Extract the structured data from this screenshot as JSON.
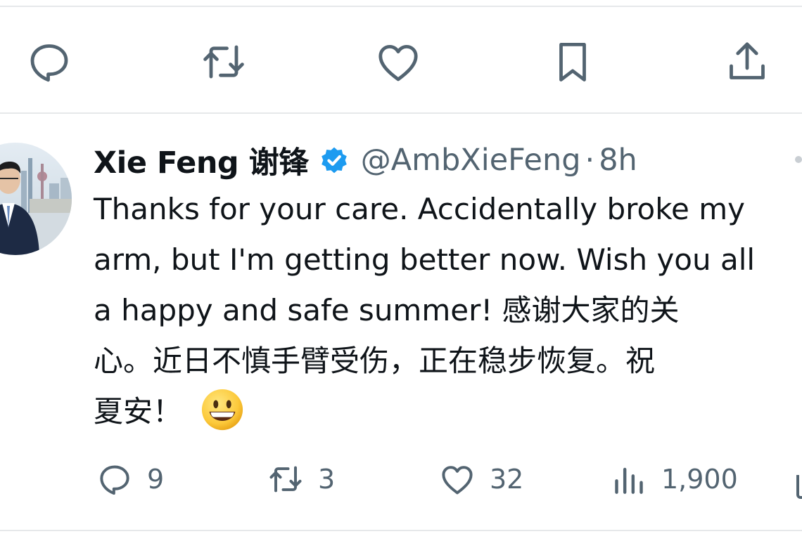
{
  "tweet": {
    "author": {
      "display_name": "Xie Feng 谢锋",
      "handle": "@AmbXieFeng",
      "separator": "·",
      "time": "8h",
      "verified": true
    },
    "text_lines": [
      "Thanks for your care. Accidentally broke my",
      "arm, but I'm getting better now. Wish you all",
      "a happy and safe summer!  感谢大家的关",
      "心。近日不慎手臂受伤，正在稳步恢复。祝",
      "夏安！"
    ],
    "emoji": "smiley-face",
    "stats": {
      "replies": "9",
      "retweets": "3",
      "likes": "32",
      "views": "1,900"
    }
  },
  "top_actions": [
    "reply-icon",
    "retweet-icon",
    "like-icon",
    "bookmark-icon",
    "share-icon"
  ],
  "colors": {
    "icon_gray": "#536471",
    "text": "#0f1419",
    "verified_blue": "#1d9bf0",
    "divider": "#e6e8ea"
  }
}
